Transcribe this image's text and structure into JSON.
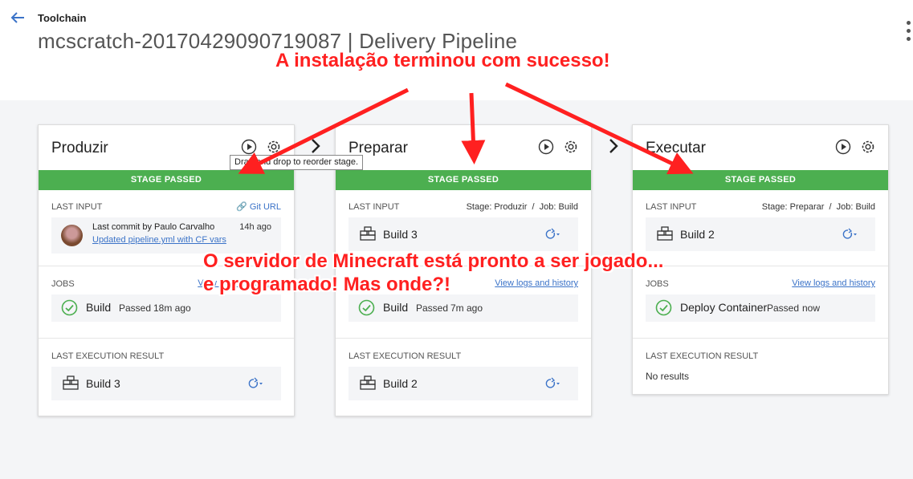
{
  "header": {
    "breadcrumb": "Toolchain",
    "title": "mcscratch-20170429090719087 | Delivery Pipeline"
  },
  "stages": [
    {
      "name": "Produzir",
      "status": "STAGE PASSED",
      "last_input_label": "LAST INPUT",
      "git_link": "Git URL",
      "commit_by": "Last commit by Paulo Carvalho",
      "commit_time": "14h ago",
      "commit_msg": "Updated pipeline.yml with CF vars",
      "jobs_label": "JOBS",
      "jobs_link": "View logs and history",
      "job_name": "Build",
      "job_status": "Passed",
      "job_time": "18m ago",
      "result_label": "LAST EXECUTION RESULT",
      "result_build": "Build 3"
    },
    {
      "name": "Preparar",
      "status": "STAGE PASSED",
      "last_input_label": "LAST INPUT",
      "input_source": "Stage: Produzir  /  Job: Build",
      "input_build": "Build 3",
      "jobs_label": "JOBS",
      "jobs_link": "View logs and history",
      "job_name": "Build",
      "job_status": "Passed",
      "job_time": "7m ago",
      "result_label": "LAST EXECUTION RESULT",
      "result_build": "Build 2"
    },
    {
      "name": "Executar",
      "status": "STAGE PASSED",
      "last_input_label": "LAST INPUT",
      "input_source": "Stage: Preparar  /  Job: Build",
      "input_build": "Build 2",
      "jobs_label": "JOBS",
      "jobs_link": "View logs and history",
      "job_name": "Deploy Container",
      "job_status": "Passed",
      "job_time": "now",
      "result_label": "LAST EXECUTION RESULT",
      "no_results": "No results"
    }
  ],
  "tooltip": "Drag and drop to reorder stage.",
  "annotations": {
    "top": "A instalação terminou com sucesso!",
    "middle_line1": "O servidor de Minecraft está pronto a ser jogado...",
    "middle_line2": "e programado! Mas onde?!"
  },
  "colors": {
    "stage_passed": "#4caf50",
    "link": "#3b73c8",
    "annotation": "#ff2020"
  }
}
